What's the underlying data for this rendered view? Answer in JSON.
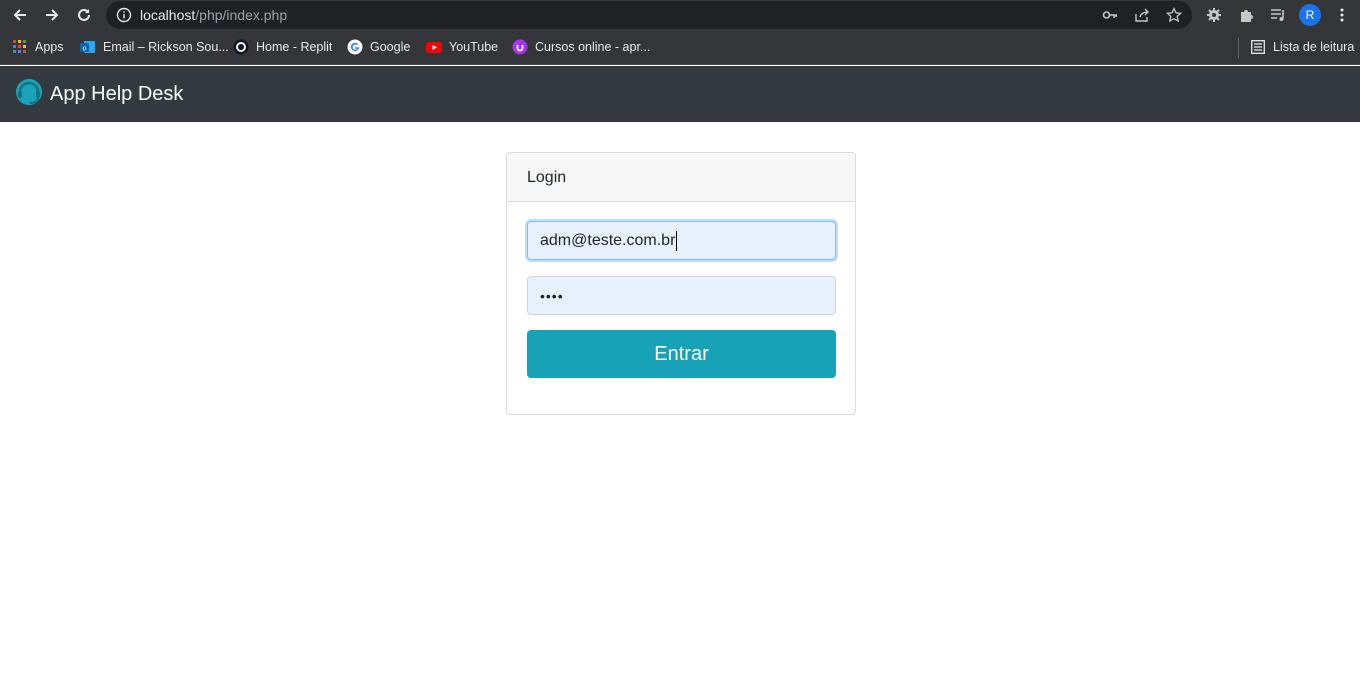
{
  "browser": {
    "url_host": "localhost",
    "url_path": "/php/index.php",
    "profile_initial": "R",
    "bookmarks": [
      {
        "label": "Apps",
        "icon": "apps-grid-icon"
      },
      {
        "label": "Email – Rickson Sou...",
        "icon": "outlook-icon"
      },
      {
        "label": "Home - Replit",
        "icon": "replit-icon"
      },
      {
        "label": "Google",
        "icon": "google-icon"
      },
      {
        "label": "YouTube",
        "icon": "youtube-icon"
      },
      {
        "label": "Cursos online - apr...",
        "icon": "udemy-icon"
      }
    ],
    "reading_list_label": "Lista de leitura"
  },
  "navbar": {
    "brand": "App Help Desk",
    "logo_icon": "headset-logo-icon"
  },
  "login": {
    "title": "Login",
    "email_value": "adm@teste.com.br",
    "password_value": "••••",
    "submit_label": "Entrar"
  },
  "colors": {
    "navbar_bg": "#343a40",
    "button_bg": "#17a2b8",
    "autofill_bg": "#e8f0fe"
  }
}
